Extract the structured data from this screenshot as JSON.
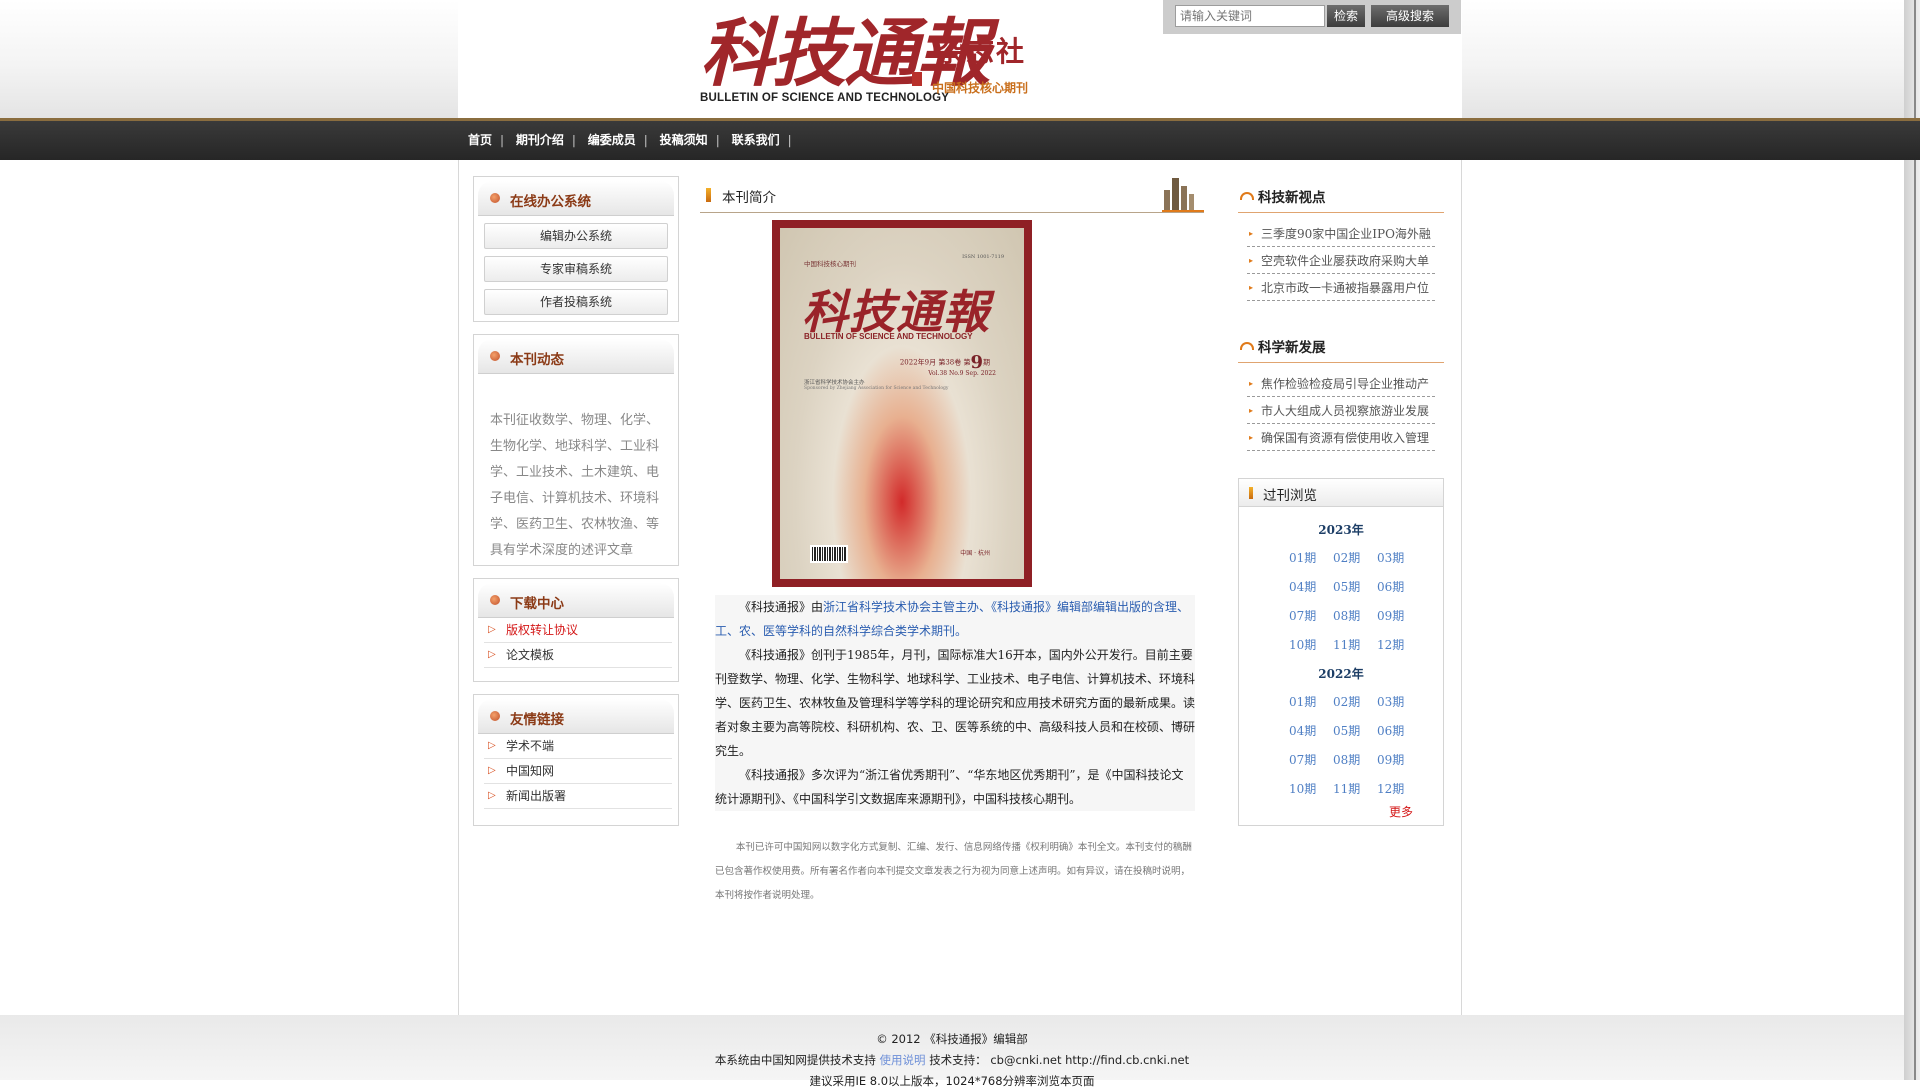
{
  "header": {
    "logo_cn": "科技通報",
    "logo_en": "BULLETIN OF SCIENCE AND TECHNOLOGY",
    "logo_society": "杂志社",
    "logo_tagline": "中国科技核心期刊",
    "search_placeholder": "请输入关键词",
    "search_button": "检索",
    "advanced_button": "高级搜索"
  },
  "nav": {
    "items": [
      "首页",
      "期刊介绍",
      "编委成员",
      "投稿须知",
      "联系我们"
    ]
  },
  "left": {
    "office": {
      "title": "在线办公系统",
      "buttons": [
        "编辑办公系统",
        "专家审稿系统",
        "作者投稿系统"
      ]
    },
    "news": {
      "title": "本刊动态",
      "text": "本刊征收数学、物理、化学、生物化学、地球科学、工业科学、工业技术、土木建筑、电子电信、计算机技术、环境科学、医药卫生、农林牧渔、等具有学术深度的述评文章"
    },
    "download": {
      "title": "下载中心",
      "items": [
        "版权转让协议",
        "论文模板"
      ]
    },
    "links": {
      "title": "友情链接",
      "items": [
        "学术不端",
        "中国知网",
        "新闻出版署"
      ]
    }
  },
  "center": {
    "title": "本刊简介",
    "cover": {
      "top_label": "中国科技核心期刊",
      "issn": "ISSN 1001-7119",
      "title": "科技通報",
      "title_en": "BULLETIN OF SCIENCE AND TECHNOLOGY",
      "issue_prefix": "2022年9月 第38卷 第",
      "issue_no": "9",
      "issue_suffix": "期",
      "vol_line": "Vol.38  No.9  Sep. 2022",
      "sponsor": "浙江省科学技术协会主办",
      "sponsor_en": "Sponsored by Zhejiang Association for Science and Technology",
      "city": "中国 · 杭州"
    },
    "p1_a": "《科技通报》由",
    "p1_b": "浙江省科学技术协会主管主办、《科技通报》编辑部编辑出版的含理、工、农、医等学科的自然科学综合类学术期刊。",
    "p2": "《科技通报》创刊于1985年，月刊，国际标准大16开本，国内外公开发行。目前主要刊登数学、物理、化学、生物科学、地球科学、工业技术、电子电信、计算机技术、环境科学、医药卫生、农林牧鱼及管理科学等学科的理论研究和应用技术研究方面的最新成果。读者对象主要为高等院校、科研机构、农、卫、医等系统的中、高级科技人员和在校硕、博研究生。",
    "p3": "《科技通报》多次评为“浙江省优秀期刊”、“华东地区优秀期刊”，是《中国科技论文统计源期刊》、《中国科学引文数据库来源期刊》，中国科技核心期刊。",
    "notice": "本刊已许可中国知网以数字化方式复制、汇编、发行、信息网络传播《权利明确》本刊全文。本刊支付的稿酬已包含著作权使用费。所有署名作者向本刊提交文章发表之行为视为同意上述声明。如有异议，请在投稿时说明，本刊将按作者说明处理。"
  },
  "right": {
    "tech": {
      "title": "科技新视点",
      "items": [
        "三季度90家中国企业IPO海外融",
        "空壳软件企业屡获政府采购大单",
        "北京市政一卡通被指暴露用户位"
      ]
    },
    "science": {
      "title": "科学新发展",
      "items": [
        "焦作检验检疫局引导企业推动产",
        "市人大组成人员视察旅游业发展",
        "确保国有资源有偿使用收入管理"
      ]
    },
    "archive": {
      "title": "过刊浏览",
      "years": [
        {
          "year": "2023年",
          "issues": [
            "01期",
            "02期",
            "03期",
            "04期",
            "05期",
            "06期",
            "07期",
            "08期",
            "09期",
            "10期",
            "11期",
            "12期"
          ]
        },
        {
          "year": "2022年",
          "issues": [
            "01期",
            "02期",
            "03期",
            "04期",
            "05期",
            "06期",
            "07期",
            "08期",
            "09期",
            "10期",
            "11期",
            "12期"
          ]
        }
      ],
      "more": "更多"
    }
  },
  "footer": {
    "line1": "© 2012 《科技通报》编辑部",
    "line2_a": "本系统由中国知网提供技术支持",
    "line2_link": "使用说明",
    "line2_b": "技术支持： cb@cnki.net http://find.cb.cnki.net",
    "line3": "建议采用IE 8.0以上版本，1024*768分辨率浏览本页面"
  }
}
